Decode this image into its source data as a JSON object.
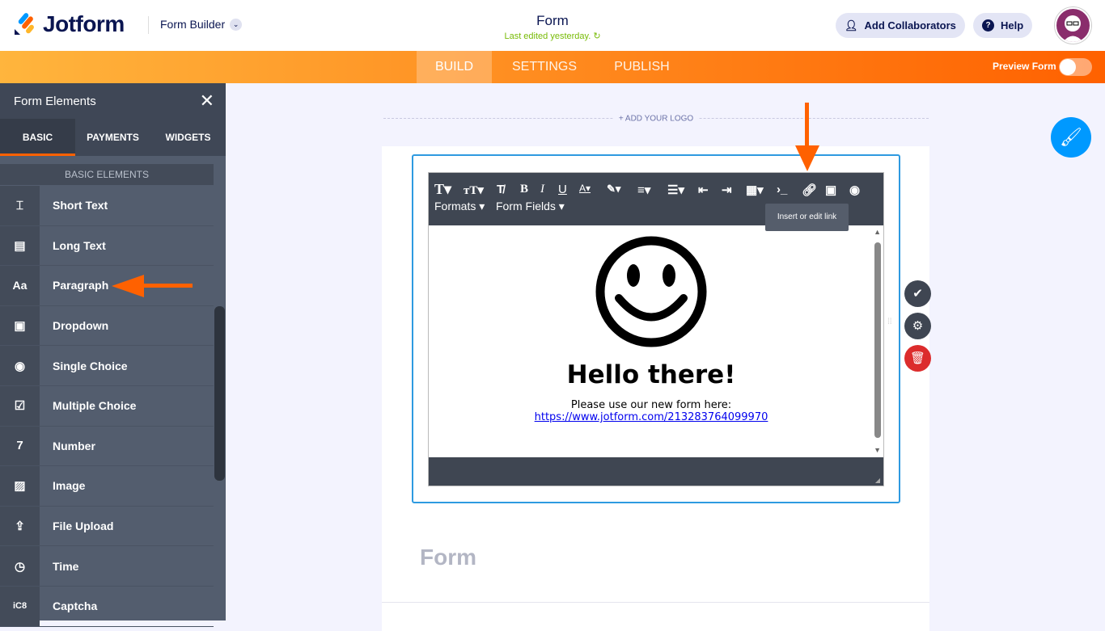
{
  "header": {
    "brand": "Jotform",
    "builder_label": "Form Builder",
    "form_title": "Form",
    "last_edited": "Last edited yesterday.",
    "add_collaborators": "Add Collaborators",
    "help": "Help"
  },
  "nav": {
    "tabs": [
      "BUILD",
      "SETTINGS",
      "PUBLISH"
    ],
    "active": "BUILD",
    "preview_label": "Preview Form",
    "preview_on": false
  },
  "sidebar": {
    "title": "Form Elements",
    "tabs": [
      "BASIC",
      "PAYMENTS",
      "WIDGETS"
    ],
    "active_tab": "BASIC",
    "section": "BASIC ELEMENTS",
    "items": [
      {
        "label": "Short Text",
        "icon": "short-text-icon"
      },
      {
        "label": "Long Text",
        "icon": "long-text-icon"
      },
      {
        "label": "Paragraph",
        "icon": "paragraph-icon"
      },
      {
        "label": "Dropdown",
        "icon": "dropdown-icon"
      },
      {
        "label": "Single Choice",
        "icon": "radio-icon"
      },
      {
        "label": "Multiple Choice",
        "icon": "checkbox-icon"
      },
      {
        "label": "Number",
        "icon": "number-icon"
      },
      {
        "label": "Image",
        "icon": "image-icon"
      },
      {
        "label": "File Upload",
        "icon": "upload-icon"
      },
      {
        "label": "Time",
        "icon": "clock-icon"
      },
      {
        "label": "Captcha",
        "icon": "captcha-icon"
      }
    ]
  },
  "canvas": {
    "add_logo": "+ ADD YOUR LOGO",
    "form_heading": "Form"
  },
  "editor": {
    "formats": "Formats",
    "form_fields": "Form Fields",
    "tooltip": "Insert or edit link",
    "heading": "Hello there!",
    "text": "Please use our new form here:",
    "link": "https://www.jotform.com/213283764099970"
  },
  "colors": {
    "accent": "#ff6100",
    "selection": "#2e9ae0",
    "delete": "#dc2c2c"
  }
}
